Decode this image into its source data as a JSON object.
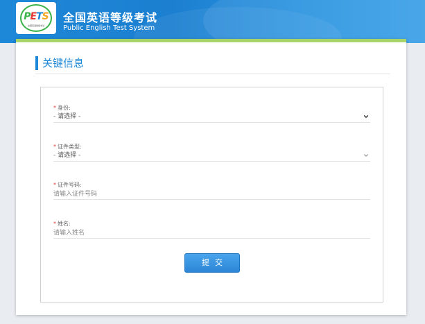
{
  "header": {
    "logo_text": "PETS",
    "logo_subtitle": "全国英语等级考试",
    "title_cn": "全国英语等级考试",
    "title_en": "Public English Test System"
  },
  "section": {
    "title": "关键信息"
  },
  "form": {
    "fields": [
      {
        "required_mark": "*",
        "label": "身份:",
        "type": "select",
        "value": "- 请选择 -",
        "icon": "chevron-down-icon"
      },
      {
        "required_mark": "*",
        "label": "证件类型:",
        "type": "select",
        "value": "- 请选择 -",
        "icon": "chevron-down-icon"
      },
      {
        "required_mark": "*",
        "label": "证件号码:",
        "type": "input",
        "placeholder": "请输入证件号码"
      },
      {
        "required_mark": "*",
        "label": "姓名:",
        "type": "input",
        "placeholder": "请输入姓名"
      }
    ],
    "submit_label": "提交"
  },
  "colors": {
    "brand_blue": "#1e88d8",
    "accent_green": "#a8d46a",
    "required_red": "#e53935"
  }
}
